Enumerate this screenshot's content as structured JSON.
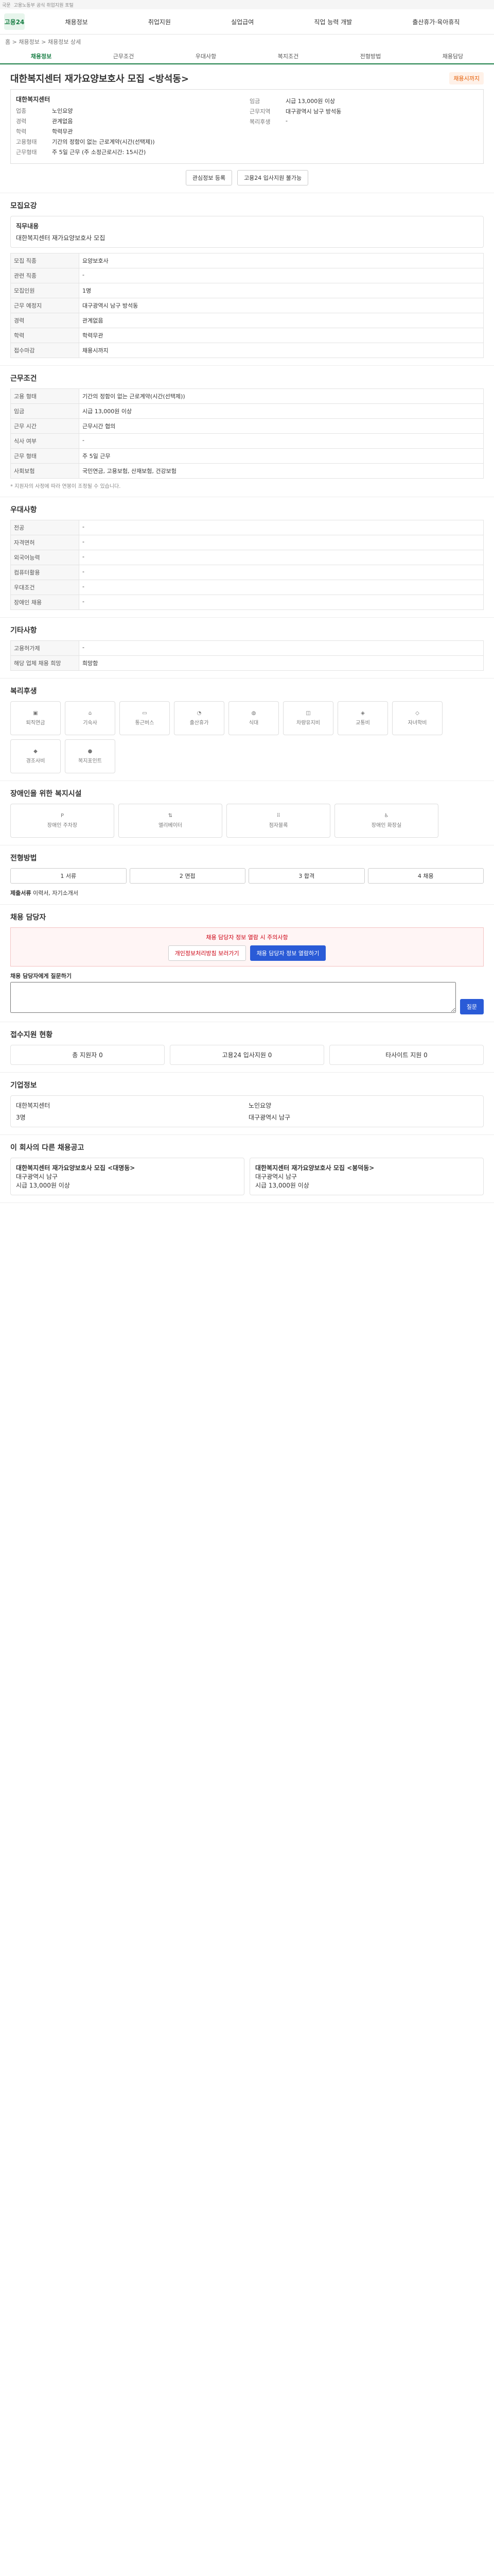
{
  "topbar": {
    "lang": "국문",
    "sub": "고용노동부 공식 취업지원 포털"
  },
  "gnb": {
    "logo": "고용24",
    "menu": [
      "채용정보",
      "취업지원",
      "실업급여",
      "직업 능력 개발",
      "출산휴가·육아휴직"
    ]
  },
  "breadcrumb": "홈 > 채용정보 > 채용정보 상세",
  "tabs": [
    "채용정보",
    "근무조건",
    "우대사항",
    "복지조건",
    "전형방법",
    "채용담당"
  ],
  "job": {
    "title": "대한복지센터 재가요양보호사 모집 <방석동>",
    "badge": "채용시까지",
    "company": "대한복지센터",
    "summary_left": [
      {
        "k": "업종",
        "v": "노인요양"
      },
      {
        "k": "경력",
        "v": "관계없음"
      },
      {
        "k": "학력",
        "v": "학력무관"
      },
      {
        "k": "고용형태",
        "v": "기간의 정함이 없는 근로계약(시간(선택제))"
      },
      {
        "k": "근무형태",
        "v": "주 5일 근무 (주 소정근로시간: 15시간)"
      }
    ],
    "summary_right": [
      {
        "k": "임금",
        "v": "시급 13,000원 이상"
      },
      {
        "k": "근무지역",
        "v": "대구광역시 남구 방석동"
      },
      {
        "k": "복리후생",
        "v": "-"
      }
    ],
    "share_btn": "관심정보 등록",
    "apply_btn": "고용24 입사지원 불가능"
  },
  "workdetail": {
    "title": "모집요강",
    "duty_title": "직무내용",
    "duty_text": "대한복지센터 재가요양보호사 모집"
  },
  "conditions": {
    "rows": [
      {
        "k": "모집 직종",
        "v": "요양보호사"
      },
      {
        "k": "관련 직종",
        "v": "-"
      },
      {
        "k": "모집인원",
        "v": "1명"
      },
      {
        "k": "근무 예정지",
        "v": "대구광역시 남구 방석동"
      },
      {
        "k": "경력",
        "v": "관계없음"
      },
      {
        "k": "학력",
        "v": "학력무관"
      },
      {
        "k": "접수마감",
        "v": "채용시까지"
      }
    ]
  },
  "workconditions": {
    "title": "근무조건",
    "rows": [
      {
        "k": "고용 형태",
        "v": "기간의 정함이 없는 근로계약(시간(선택제))"
      },
      {
        "k": "임금",
        "v": "시급 13,000원 이상"
      },
      {
        "k": "근무 시간",
        "v": "근무시간 협의"
      },
      {
        "k": "식사 여부",
        "v": "-"
      },
      {
        "k": "근무 형태",
        "v": "주 5일 근무"
      },
      {
        "k": "사회보험",
        "v": "국민연금, 고용보험, 산재보험, 건강보험"
      }
    ],
    "note": "* 지원자의 사정에 따라 연봉이 조정될 수 있습니다."
  },
  "preference": {
    "title": "우대사항",
    "rows": [
      {
        "k": "전공",
        "v": "-"
      },
      {
        "k": "자격면허",
        "v": "-"
      },
      {
        "k": "외국어능력",
        "v": "-"
      },
      {
        "k": "컴퓨터활용",
        "v": "-"
      },
      {
        "k": "우대조건",
        "v": "-"
      },
      {
        "k": "장애인 채용",
        "v": "-"
      }
    ]
  },
  "other": {
    "title": "기타사항",
    "rows": [
      {
        "k": "고용허가제",
        "v": "-"
      },
      {
        "k": "해당 업체 채용 희망",
        "v": "희망함"
      }
    ]
  },
  "welfare": {
    "title": "복리후생",
    "items": [
      "퇴직연금",
      "기숙사",
      "통근버스",
      "출산휴가",
      "식대",
      "차량유지비",
      "교통비",
      "자녀학비",
      "경조사비",
      "복지포인트"
    ]
  },
  "disability": {
    "title": "장애인을 위한 복지시설",
    "items": [
      "장애인 주차장",
      "엘리베이터",
      "점자블록",
      "장애인 화장실"
    ]
  },
  "selection": {
    "title": "전형방법",
    "steps": [
      "1 서류",
      "2 면접",
      "3 합격",
      "4 채용"
    ],
    "docs_title": "제출서류",
    "docs": "이력서, 자기소개서"
  },
  "contact": {
    "title": "채용 담당자",
    "alert": "채용 담당자 정보 열람 시 주의사항",
    "btn1": "개인정보처리방침 보러가기",
    "btn2": "채용 담당자 정보 열람하기",
    "question_title": "채용 담당자에게 질문하기",
    "question_btn": "질문"
  },
  "apply": {
    "title": "접수지원 현황",
    "stats": [
      "총 지원자 0",
      "고용24 입사지원 0",
      "타사이트 지원 0"
    ]
  },
  "company_info": {
    "title": "기업정보",
    "name": "대한복지센터",
    "industry": "노인요양",
    "employees": "3명",
    "address": "대구광역시 남구"
  },
  "recommend": {
    "title": "이 회사의 다른 채용공고",
    "cards": [
      {
        "title": "대한복지센터 재가요양보호사 모집 <대명동>",
        "loc": "대구광역시 남구",
        "pay": "시급 13,000원 이상"
      },
      {
        "title": "대한복지센터 재가요양보호사 모집 <봉덕동>",
        "loc": "대구광역시 남구",
        "pay": "시급 13,000원 이상"
      }
    ]
  }
}
